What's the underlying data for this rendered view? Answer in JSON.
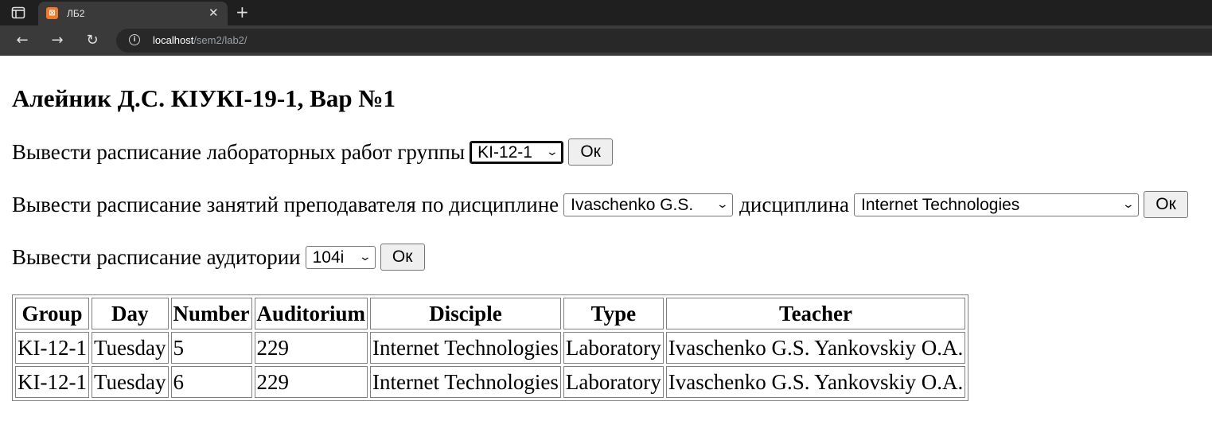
{
  "browser": {
    "tab_title": "ЛБ2",
    "favicon_label": "⊠",
    "url_host": "localhost",
    "url_path": "/sem2/lab2/",
    "icons": {
      "tab_switch": "tab-switcher-icon",
      "close": "close-icon",
      "new_tab": "plus-icon",
      "back": "back-arrow-icon",
      "forward": "forward-arrow-icon",
      "reload": "reload-icon",
      "info": "info-icon"
    }
  },
  "page": {
    "heading": "Алейник Д.С. КІУКІ-19-1, Вар №1",
    "group_form": {
      "label": "Вывести расписание лабораторных работ группы",
      "selected": "KI-12-1",
      "button": "Ок"
    },
    "teacher_form": {
      "label": "Вывести расписание занятий преподавателя по дисциплине",
      "teacher_selected": "Ivaschenko G.S.",
      "discipline_label": "дисциплина",
      "discipline_selected": "Internet Technologies",
      "button": "Ок"
    },
    "auditorium_form": {
      "label": "Вывести расписание аудитории",
      "selected": "104i",
      "button": "Ок"
    },
    "table": {
      "headers": [
        "Group",
        "Day",
        "Number",
        "Auditorium",
        "Disciple",
        "Type",
        "Teacher"
      ],
      "rows": [
        [
          "KI-12-1",
          "Tuesday",
          "5",
          "229",
          "Internet Technologies",
          "Laboratory",
          "Ivaschenko G.S. Yankovskiy O.A."
        ],
        [
          "KI-12-1",
          "Tuesday",
          "6",
          "229",
          "Internet Technologies",
          "Laboratory",
          "Ivaschenko G.S. Yankovskiy O.A."
        ]
      ]
    }
  }
}
